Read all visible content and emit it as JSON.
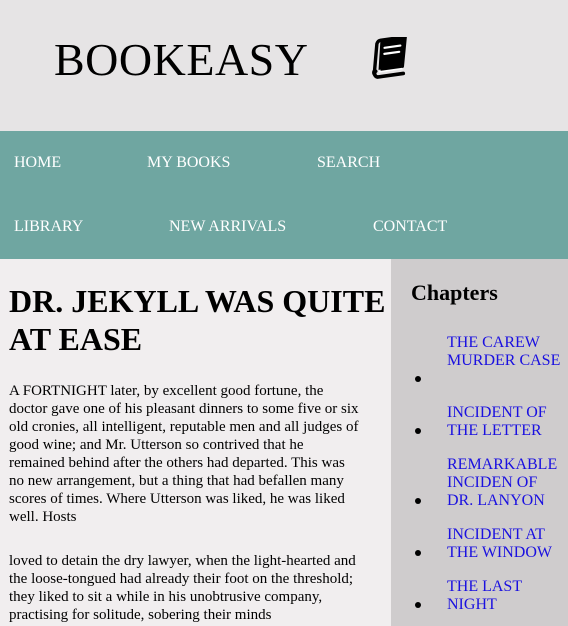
{
  "brand": {
    "name": "BOOKEASY",
    "icon": "book-icon"
  },
  "nav": {
    "items": [
      {
        "label": "HOME"
      },
      {
        "label": "MY BOOKS"
      },
      {
        "label": "SEARCH"
      },
      {
        "label": "LIBRARY"
      },
      {
        "label": "NEW ARRIVALS"
      },
      {
        "label": "CONTACT"
      }
    ]
  },
  "main": {
    "title": "DR. JEKYLL WAS QUITE AT EASE",
    "paragraphs": [
      "A FORTNIGHT later, by excellent good fortune, the doctor gave one of his pleasant dinners to some five or six old cronies, all intelligent, reputable men and all judges of good wine; and Mr. Utterson so contrived that he remained behind after the others had departed. This was no new arrangement, but a thing that had befallen many scores of times. Where Utterson was liked, he was liked well. Hosts",
      "loved to detain the dry lawyer, when the light-hearted and the loose-tongued had already their foot on the threshold; they liked to sit a while in his unobtrusive company, practising for solitude, sobering their minds"
    ]
  },
  "aside": {
    "title": "Chapters",
    "chapters": [
      "THE CAREW MURDER CASE",
      "INCIDENT OF THE LETTER",
      "REMARKABLE INCIDEN OF DR. LANYON",
      "INCIDENT AT THE WINDOW",
      "THE LAST NIGHT"
    ]
  },
  "colors": {
    "header_bg": "#e6e4e5",
    "nav_bg": "#6fa6a1",
    "nav_text": "#ffffff",
    "main_bg": "#f1eeef",
    "aside_bg": "#cfcccd",
    "link": "#1a10e0"
  }
}
